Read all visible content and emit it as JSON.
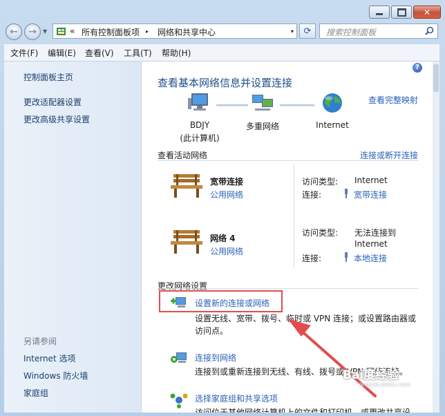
{
  "address": {
    "chevron": "«",
    "crumb1": "所有控制面板项",
    "separator": "▸",
    "crumb2": "网络和共享中心",
    "dropdown": "▾"
  },
  "search": {
    "placeholder": "搜索控制面板"
  },
  "menu": [
    "文件(F)",
    "编辑(E)",
    "查看(V)",
    "工具(T)",
    "帮助(H)"
  ],
  "sidebar": {
    "links": [
      "控制面板主页",
      "更改适配器设置",
      "更改高级共享设置"
    ],
    "see_also_heading": "另请参阅",
    "see_also": [
      "Internet 选项",
      "Windows 防火墙",
      "家庭组"
    ]
  },
  "main": {
    "help_label": "?",
    "heading": "查看基本网络信息并设置连接",
    "full_map_link": "查看完整映射",
    "map_nodes": [
      {
        "label1": "BDJY",
        "label2": "(此计算机)",
        "icon": "computer-icon"
      },
      {
        "label1": "多重网络",
        "label2": "",
        "icon": "network-icon"
      },
      {
        "label1": "Internet",
        "label2": "",
        "icon": "globe-icon"
      }
    ],
    "active_title": "查看活动网络",
    "connect_disconnect_link": "连接或断开连接",
    "networks": [
      {
        "name": "宽带连接",
        "type": "公用网络",
        "access_label": "访问类型:",
        "access_value": "Internet",
        "conn_label": "连接:",
        "conn_value": "宽带连接"
      },
      {
        "name": "网络  4",
        "type": "公用网络",
        "access_label": "访问类型:",
        "access_value": "无法连接到",
        "access_value2": "Internet",
        "conn_label": "连接:",
        "conn_value": "本地连接"
      }
    ],
    "change_title": "更改网络设置",
    "tasks": [
      {
        "link": "设置新的连接或网络",
        "desc": "设置无线、宽带、拨号、临时或 VPN 连接；或设置路由器或访问点。",
        "icon": "new-connection-icon"
      },
      {
        "link": "连接到网络",
        "desc": "连接到或重新连接到无线、有线、拨号或 VPN 网络连接。",
        "icon": "connect-network-icon"
      },
      {
        "link": "选择家庭组和共享选项",
        "desc": "访问位于其他网络计算机上的文件和打印机，或更改共享设置。",
        "icon": "homegroup-icon"
      }
    ]
  },
  "watermark": {
    "text": "Bai度经验",
    "sub": "jingyan.baidu.com"
  },
  "colors": {
    "link": "#2a62b9",
    "heading": "#1e4f8c",
    "highlight": "#e24c4c"
  }
}
